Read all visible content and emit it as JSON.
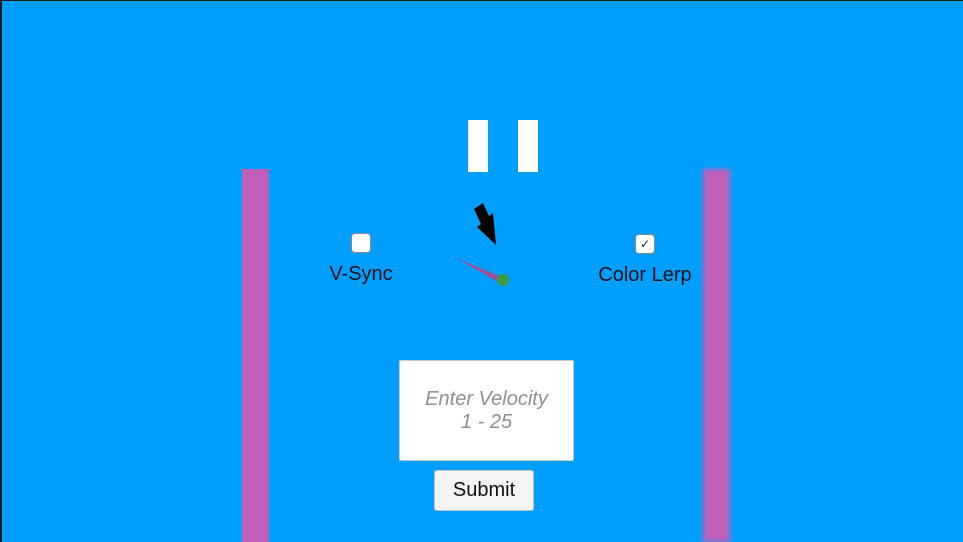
{
  "colors": {
    "background": "#009FFF",
    "wall": "#BF5FBA",
    "ball": "#3E9A3E",
    "trail": "#A0509A",
    "arrow": "#000000"
  },
  "pause": {
    "icon": "pause-icon"
  },
  "vsync": {
    "label": "V-Sync",
    "checked": false,
    "check_glyph": ""
  },
  "color_lerp": {
    "label": "Color Lerp",
    "checked": true,
    "check_glyph": "✓"
  },
  "velocity": {
    "value": "",
    "placeholder_line1": "Enter Velocity",
    "placeholder_line2": "1 - 25"
  },
  "submit": {
    "label": "Submit"
  }
}
